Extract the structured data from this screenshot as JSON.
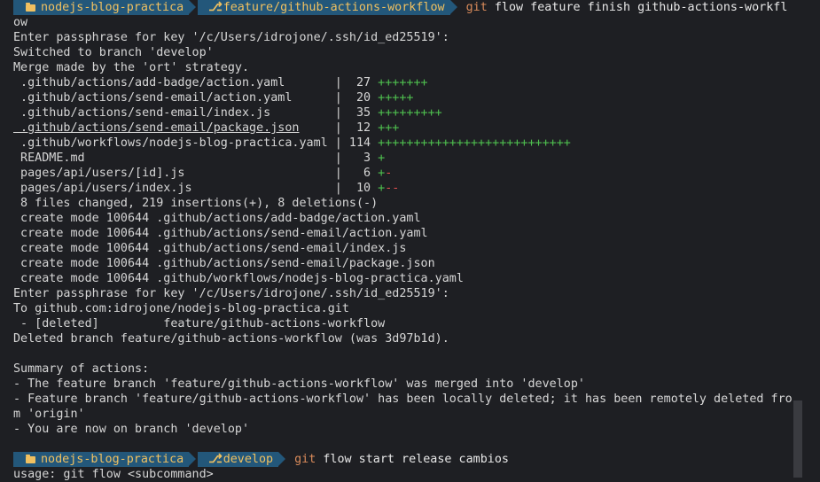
{
  "prompt1": {
    "folder": "nodejs-blog-practica",
    "branch": "feature/github-actions-workflow",
    "cmd_git": "git",
    "cmd_rest": "flow feature finish github-actions-workfl"
  },
  "lines_a": [
    "ow",
    "Enter passphrase for key '/c/Users/idrojone/.ssh/id_ed25519':",
    "Switched to branch 'develop'",
    "Merge made by the 'ort' strategy."
  ],
  "diffstat": [
    {
      "file": " .github/actions/add-badge/action.yaml       ",
      "count": "|  27 ",
      "plus": "+++++++",
      "minus": "",
      "ul": false
    },
    {
      "file": " .github/actions/send-email/action.yaml      ",
      "count": "|  20 ",
      "plus": "+++++",
      "minus": "",
      "ul": false
    },
    {
      "file": " .github/actions/send-email/index.js         ",
      "count": "|  35 ",
      "plus": "+++++++++",
      "minus": "",
      "ul": false
    },
    {
      "file": " .github/actions/send-email/package.json",
      "pad": "     ",
      "count": "|  12 ",
      "plus": "+++",
      "minus": "",
      "ul": true
    },
    {
      "file": " .github/workflows/nodejs-blog-practica.yaml ",
      "count": "| 114 ",
      "plus": "+++++++++++++++++++++++++++",
      "minus": "",
      "ul": false
    },
    {
      "file": " README.md                                   ",
      "count": "|   3 ",
      "plus": "+",
      "minus": "",
      "ul": false
    },
    {
      "file": " pages/api/users/[id].js                     ",
      "count": "|   6 ",
      "plus": "+",
      "minus": "-",
      "ul": false
    },
    {
      "file": " pages/api/users/index.js                    ",
      "count": "|  10 ",
      "plus": "+",
      "minus": "--",
      "ul": false
    }
  ],
  "lines_b": [
    " 8 files changed, 219 insertions(+), 8 deletions(-)",
    " create mode 100644 .github/actions/add-badge/action.yaml",
    " create mode 100644 .github/actions/send-email/action.yaml",
    " create mode 100644 .github/actions/send-email/index.js",
    " create mode 100644 .github/actions/send-email/package.json",
    " create mode 100644 .github/workflows/nodejs-blog-practica.yaml",
    "Enter passphrase for key '/c/Users/idrojone/.ssh/id_ed25519':",
    "To github.com:idrojone/nodejs-blog-practica.git",
    " - [deleted]         feature/github-actions-workflow",
    "Deleted branch feature/github-actions-workflow (was 3d97b1d).",
    "",
    "Summary of actions:",
    "- The feature branch 'feature/github-actions-workflow' was merged into 'develop'",
    "- Feature branch 'feature/github-actions-workflow' has been locally deleted; it has been remotely deleted fro",
    "m 'origin'",
    "- You are now on branch 'develop'",
    ""
  ],
  "prompt2": {
    "folder": "nodejs-blog-practica",
    "branch": "develop",
    "cmd_git": "git",
    "cmd_rest": "flow start release cambios"
  },
  "last_line": "usage: git flow <subcommand>"
}
